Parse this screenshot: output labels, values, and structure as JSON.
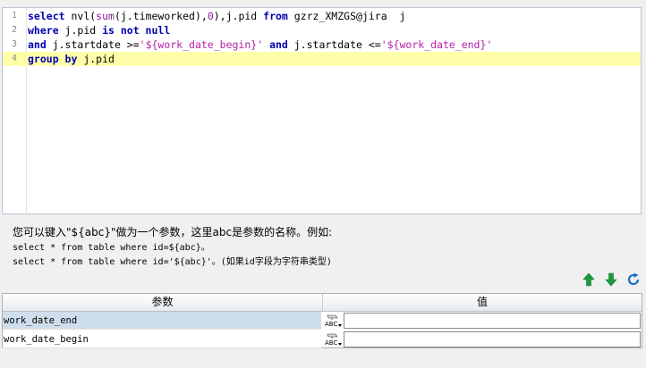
{
  "editor": {
    "lines": [
      {
        "n": "1",
        "tokens": [
          {
            "t": "kw",
            "v": "select"
          },
          {
            "t": "op",
            "v": " nvl("
          },
          {
            "t": "fn",
            "v": "sum"
          },
          {
            "t": "op",
            "v": "(j.timeworked),"
          },
          {
            "t": "num",
            "v": "0"
          },
          {
            "t": "op",
            "v": "),j.pid "
          },
          {
            "t": "kw",
            "v": "from"
          },
          {
            "t": "op",
            "v": " gzrz_XMZGS@jira  j"
          }
        ]
      },
      {
        "n": "2",
        "tokens": [
          {
            "t": "kw",
            "v": "where"
          },
          {
            "t": "op",
            "v": " j.pid "
          },
          {
            "t": "kw",
            "v": "is not null"
          }
        ]
      },
      {
        "n": "3",
        "tokens": [
          {
            "t": "kw",
            "v": "and"
          },
          {
            "t": "op",
            "v": " j.startdate >="
          },
          {
            "t": "str",
            "v": "'${work_date_begin}'"
          },
          {
            "t": "op",
            "v": " "
          },
          {
            "t": "kw",
            "v": "and"
          },
          {
            "t": "op",
            "v": " j.startdate <="
          },
          {
            "t": "str",
            "v": "'${work_date_end}'"
          }
        ]
      },
      {
        "n": "4",
        "current": true,
        "tokens": [
          {
            "t": "kw",
            "v": "group by"
          },
          {
            "t": "op",
            "v": " j.pid"
          }
        ]
      }
    ]
  },
  "hint": {
    "title": "您可以键入\"${abc}\"做为一个参数，这里abc是参数的名称。例如:",
    "example1": "select * from table where id=${abc}。",
    "example2": "select * from table where id='${abc}'。(如果id字段为字符串类型)"
  },
  "toolbar": {
    "up_icon": "arrow-up-green",
    "down_icon": "arrow-down-green",
    "refresh_icon": "refresh-blue"
  },
  "params": {
    "col_name": "参数",
    "col_value": "值",
    "rows": [
      {
        "name": "work_date_end",
        "value": ""
      },
      {
        "name": "work_date_begin",
        "value": ""
      }
    ]
  },
  "colors": {
    "keyword": "#0000b0",
    "function": "#8e1aa0",
    "string": "#b51ea6",
    "current_line": "#ffffaa",
    "selected_row": "#cfdeec",
    "arrow_green": "#1a9a3a"
  }
}
